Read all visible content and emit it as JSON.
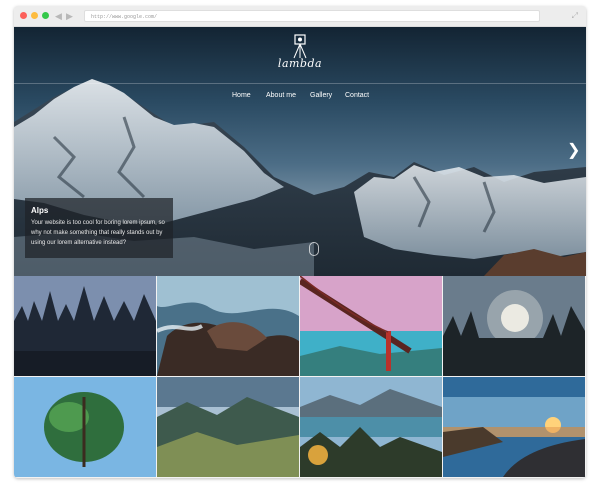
{
  "browser": {
    "url": "http://www.google.com/",
    "back_icon": "chevron-left-icon",
    "forward_icon": "chevron-right-icon",
    "expand_icon": "expand-icon"
  },
  "header": {
    "logo_text": "lambda",
    "logo_icon": "camera-tripod-icon",
    "nav": [
      "Home",
      "About me",
      "Gallery",
      "Contact"
    ]
  },
  "hero": {
    "caption_title": "Alps",
    "caption_text": "Your website is too cool for boring lorem ipsum, so why not make something that really stands out by using our lorem alternative instead?",
    "next_icon": "chevron-right-icon",
    "scroll_icon": "mouse-scroll-icon"
  },
  "gallery": [
    "forest-photo",
    "wave-rock-photo",
    "golden-gate-bridge-photo",
    "sunlit-forest-photo",
    "tree-reflection-photo",
    "green-valley-photo",
    "autumn-mountain-lake-photo",
    "coastal-road-sunset-photo"
  ],
  "colors": {
    "caption_bg": "#1e2228",
    "nav_text": "#ffffff",
    "chrome_bg": "#ededed"
  }
}
